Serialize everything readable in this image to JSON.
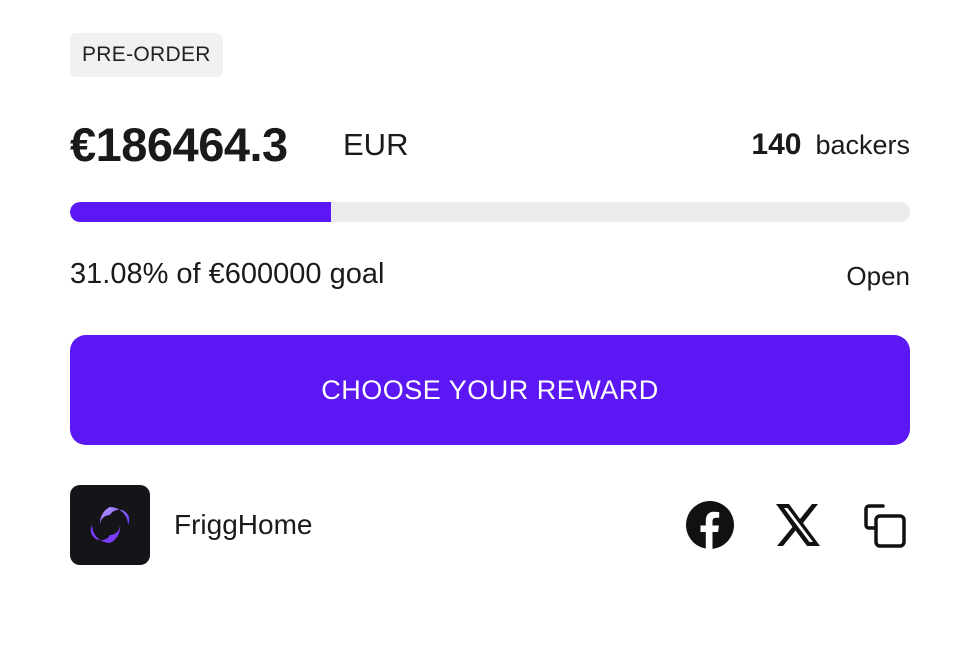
{
  "badge": {
    "label": "PRE-ORDER"
  },
  "funding": {
    "amount": "€186464.3",
    "currency": "EUR",
    "backers_count": "140",
    "backers_label": "backers",
    "progress_fraction": 0.3108,
    "goal_text": "31.08% of €600000 goal",
    "status": "Open"
  },
  "cta": {
    "label": "CHOOSE YOUR REWARD"
  },
  "creator": {
    "name": "FriggHome",
    "avatar_icon": "frigghome-logo-icon"
  },
  "share": {
    "icons": [
      "facebook-icon",
      "x-icon",
      "copy-link-icon"
    ]
  },
  "colors": {
    "accent": "#5b18f5",
    "track": "#ebebeb",
    "badge_bg": "#f1f1f3",
    "avatar_bg": "#141419",
    "text": "#1a1a1a"
  }
}
